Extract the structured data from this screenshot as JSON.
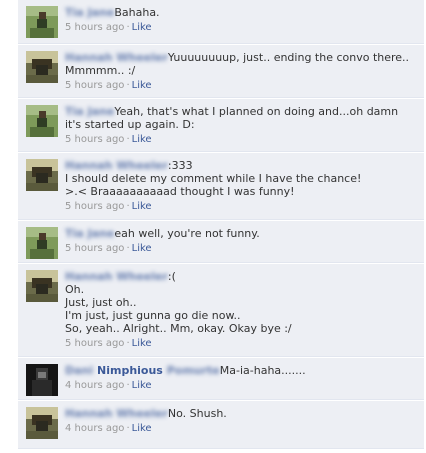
{
  "colors": {
    "comment_bg": "#edeff4",
    "link_blue": "#3b5998",
    "meta_gray": "#999999",
    "text": "#333333"
  },
  "comments": [
    {
      "author": "Tia Jane",
      "author_visible": "",
      "text": "Bahaha.",
      "time": "5 hours ago",
      "like": "Like",
      "avatar": "photo-avatar-tia"
    },
    {
      "author": "Hannah Wheeler",
      "author_visible": "",
      "text": "Yuuuuuuuup, just.. ending the convo there..\nMmmmm.. :/",
      "time": "5 hours ago",
      "like": "Like",
      "avatar": "photo-avatar-hannah"
    },
    {
      "author": "Tia Jane",
      "author_visible": "",
      "text": "Yeah, that's what I planned on doing and...oh damn it's started up again. D:",
      "time": "5 hours ago",
      "like": "Like",
      "avatar": "photo-avatar-tia"
    },
    {
      "author": "Hannah Wheeler",
      "author_visible": "",
      "text": ":333\nI should delete my comment while I have the chance!\n>.< Braaaaaaaaaad thought I was funny!",
      "time": "5 hours ago",
      "like": "Like",
      "avatar": "photo-avatar-hannah"
    },
    {
      "author": "Tia Jane",
      "author_visible": "",
      "text": "eah well, you're not funny.",
      "time": "5 hours ago",
      "like": "Like",
      "avatar": "photo-avatar-tia"
    },
    {
      "author": "Hannah Wheeler",
      "author_visible": "",
      "text": ":(\nOh.\nJust, just oh..\nI'm just, just gunna go die now..\nSo, yeah.. Alright.. Mm, okay. Okay bye :/",
      "time": "5 hours ago",
      "like": "Like",
      "avatar": "photo-avatar-hannah"
    },
    {
      "author": "Dani",
      "author_visible": "Nimphious",
      "author_after": "Pomurte",
      "text": "Ma-ia-haha.......",
      "time": "4 hours ago",
      "like": "Like",
      "avatar": "photo-avatar-dani"
    },
    {
      "author": "Hannah Wheeler",
      "author_visible": "",
      "text": "No. Shush.",
      "time": "4 hours ago",
      "like": "Like",
      "avatar": "photo-avatar-hannah"
    }
  ]
}
